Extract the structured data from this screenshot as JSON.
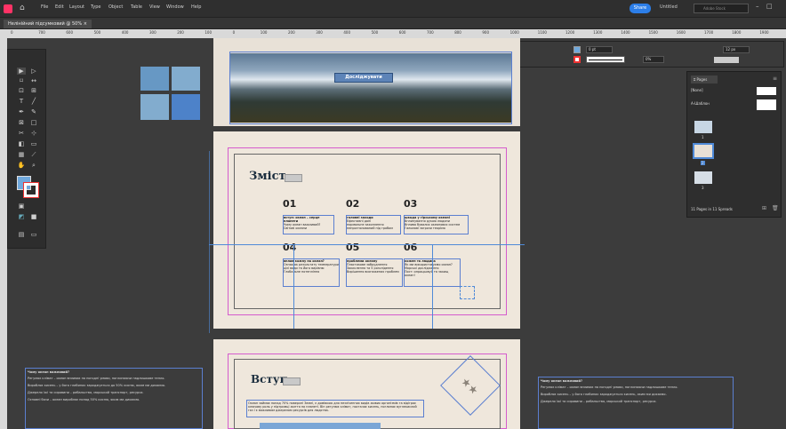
{
  "menubar": {
    "items": [
      "File",
      "Edit",
      "Layout",
      "Type",
      "Object",
      "Table",
      "View",
      "Window",
      "Help"
    ],
    "share": "Share",
    "workspace": "Untitled",
    "search_placeholder": "Adobe Stock"
  },
  "document_tab": {
    "title": "Нелінійний підсумковий @ 50%",
    "close": "×"
  },
  "ruler": {
    "labels": [
      "0",
      "700",
      "600",
      "500",
      "400",
      "300",
      "200",
      "100",
      "0",
      "100",
      "200",
      "300",
      "400",
      "500",
      "600",
      "700",
      "800",
      "900",
      "1000",
      "1100",
      "1200",
      "1300",
      "1400",
      "1500",
      "1600",
      "1700",
      "1800",
      "1900",
      "2000"
    ]
  },
  "control": {
    "x": "446,602 px",
    "y": "408,864 px",
    "w": "96,175 px",
    "h": "39,3 px",
    "scale_x": "100%",
    "scale_y": "100%",
    "rot": "0°",
    "shear": "0°",
    "stroke": "0 pt",
    "opacity": "0%",
    "size": "12 px"
  },
  "page1": {
    "button": "Досліджувати"
  },
  "toc": {
    "title": "Зміст",
    "items": [
      {
        "n": "01",
        "heading": "вступ: океан – серце планети",
        "lines": [
          "Чому океан важливий?",
          "Світові океани"
        ]
      },
      {
        "n": "02",
        "heading": "головні заходи",
        "lines": [
          "Ефективні дані",
          "нормальне захоплення",
          "непрогнозований під гробом"
        ]
      },
      {
        "n": "03",
        "heading": "шкода у гірському океані",
        "lines": [
          "Вплинування рукою людини",
          "Вплива бувалих океанових систем",
          "Гальмові загрози теорією"
        ]
      },
      {
        "n": "04",
        "heading": "вплив кожну на океан?",
        "lines": [
          "Ознак як результату температури",
          "цієї води та його вирівню",
          "Глобальне потепління"
        ]
      },
      {
        "n": "05",
        "heading": "проблеми океану",
        "lines": [
          "Пластикове забруднення",
          "Закислення та 5 розслідення",
          "Вирішення виснажених проблем"
        ]
      },
      {
        "n": "06",
        "heading": "кожен та людина",
        "lines": [
          "Як ми використовуємо океан?",
          "Морські дослідження",
          "Пост: опрацьовуй та захищ океан!"
        ]
      }
    ]
  },
  "intro": {
    "title": "Вступ",
    "paragraph": "Океан займає понад 70% поверхні Землі, є домівкою для незліченних видів живих організмів та відіграє ключову роль у підтримці життя на планеті. Він регулює клімат, постачає кисень, поглинає вуглекислий газ і є важливим джерелом ресурсів для людства."
  },
  "pasteboard_left": {
    "heading": "Чому океан важливий?",
    "lines": [
      "Регулює клімат – океан впливає на погодні умови, поглинаючи надлишкове тепло.",
      "Виробляє кисень – у його глибинах зароджується до 50% кисню, яким ми дихаємо.",
      "Джерело їжі та сировини – рибальство, морський транспорт, ресурси.",
      "Основні бази – океан виробляє понад 50% кисню, яким ми дихаємо."
    ]
  },
  "pasteboard_right": {
    "heading": "Чому океан важливий?",
    "lines": [
      "Регулює клімат – океан впливає на погодні умови, поглинаючи надлишкове тепло.",
      "Виробляє кисень – у його глибинах зароджується кисень, яким ми дихаємо.",
      "Джерело їжі та сировини – рибальство, морський транспорт, ресурси."
    ]
  },
  "pages_panel": {
    "tab": "Pages",
    "none": "[None]",
    "master": "A-Шаблон",
    "labels": [
      "1",
      "2",
      "3"
    ],
    "footer": "11 Pages in 11 Spreads"
  },
  "colors": {
    "accent": "#4f8ad8",
    "page": "#efe7dc",
    "swatch": "#6fa8dc"
  }
}
